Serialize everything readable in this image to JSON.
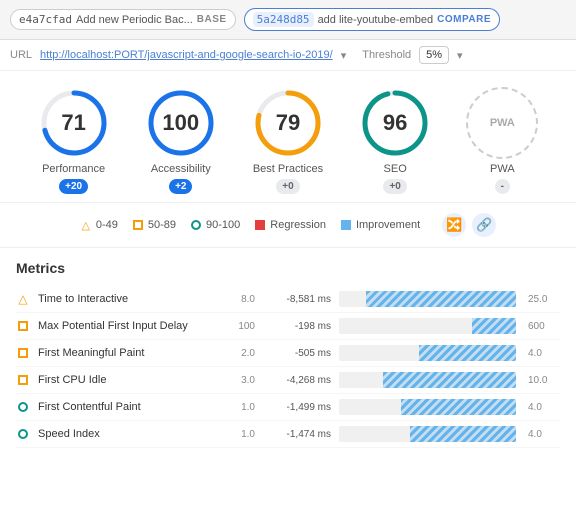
{
  "topBar": {
    "base": {
      "hash": "e4a7cfad",
      "description": "Add new Periodic Bac...",
      "label": "BASE"
    },
    "compare": {
      "hash": "5a248d85",
      "description": "add lite-youtube-embed",
      "label": "COMPARE"
    }
  },
  "urlBar": {
    "label": "URL",
    "url": "http://localhost:PORT/javascript-and-google-search-io-2019/",
    "thresholdLabel": "Threshold",
    "thresholdValue": "5%"
  },
  "scores": [
    {
      "id": "performance",
      "value": "71",
      "label": "Performance",
      "delta": "+20",
      "deltaType": "positive-blue",
      "color": "#1a73e8",
      "trackColor": "#e8eaed",
      "pct": 71
    },
    {
      "id": "accessibility",
      "value": "100",
      "label": "Accessibility",
      "delta": "+2",
      "deltaType": "positive-blue",
      "color": "#1a73e8",
      "trackColor": "#e8eaed",
      "pct": 100
    },
    {
      "id": "best-practices",
      "value": "79",
      "label": "Best Practices",
      "delta": "+0",
      "deltaType": "neutral",
      "color": "#f59e0b",
      "trackColor": "#e8eaed",
      "pct": 79
    },
    {
      "id": "seo",
      "value": "96",
      "label": "SEO",
      "delta": "+0",
      "deltaType": "neutral",
      "color": "#0d9488",
      "trackColor": "#e8eaed",
      "pct": 96
    },
    {
      "id": "pwa",
      "value": "PWA",
      "label": "PWA",
      "delta": "-",
      "deltaType": "neutral"
    }
  ],
  "legend": {
    "items": [
      {
        "id": "range-0-49",
        "icon": "triangle",
        "label": "0-49"
      },
      {
        "id": "range-50-89",
        "icon": "square",
        "label": "50-89"
      },
      {
        "id": "range-90-100",
        "icon": "circle",
        "label": "90-100"
      },
      {
        "id": "regression",
        "icon": "rect-red",
        "label": "Regression"
      },
      {
        "id": "improvement",
        "icon": "rect-blue",
        "label": "Improvement"
      }
    ],
    "action1": "🔀",
    "action2": "🔗"
  },
  "metrics": {
    "title": "Metrics",
    "rows": [
      {
        "id": "time-to-interactive",
        "icon": "triangle",
        "name": "Time to Interactive",
        "base": "8.0",
        "delta": "-8,581 ms",
        "barPct": 85,
        "max": "25.0"
      },
      {
        "id": "max-potential-fid",
        "icon": "square",
        "name": "Max Potential First Input Delay",
        "base": "100",
        "delta": "-198 ms",
        "barPct": 25,
        "max": "600"
      },
      {
        "id": "first-meaningful-paint",
        "icon": "square",
        "name": "First Meaningful Paint",
        "base": "2.0",
        "delta": "-505 ms",
        "barPct": 55,
        "max": "4.0"
      },
      {
        "id": "first-cpu-idle",
        "icon": "square",
        "name": "First CPU Idle",
        "base": "3.0",
        "delta": "-4,268 ms",
        "barPct": 75,
        "max": "10.0"
      },
      {
        "id": "first-contentful-paint",
        "icon": "circle",
        "name": "First Contentful Paint",
        "base": "1.0",
        "delta": "-1,499 ms",
        "barPct": 65,
        "max": "4.0"
      },
      {
        "id": "speed-index",
        "icon": "circle",
        "name": "Speed Index",
        "base": "1.0",
        "delta": "-1,474 ms",
        "barPct": 60,
        "max": "4.0"
      }
    ]
  }
}
